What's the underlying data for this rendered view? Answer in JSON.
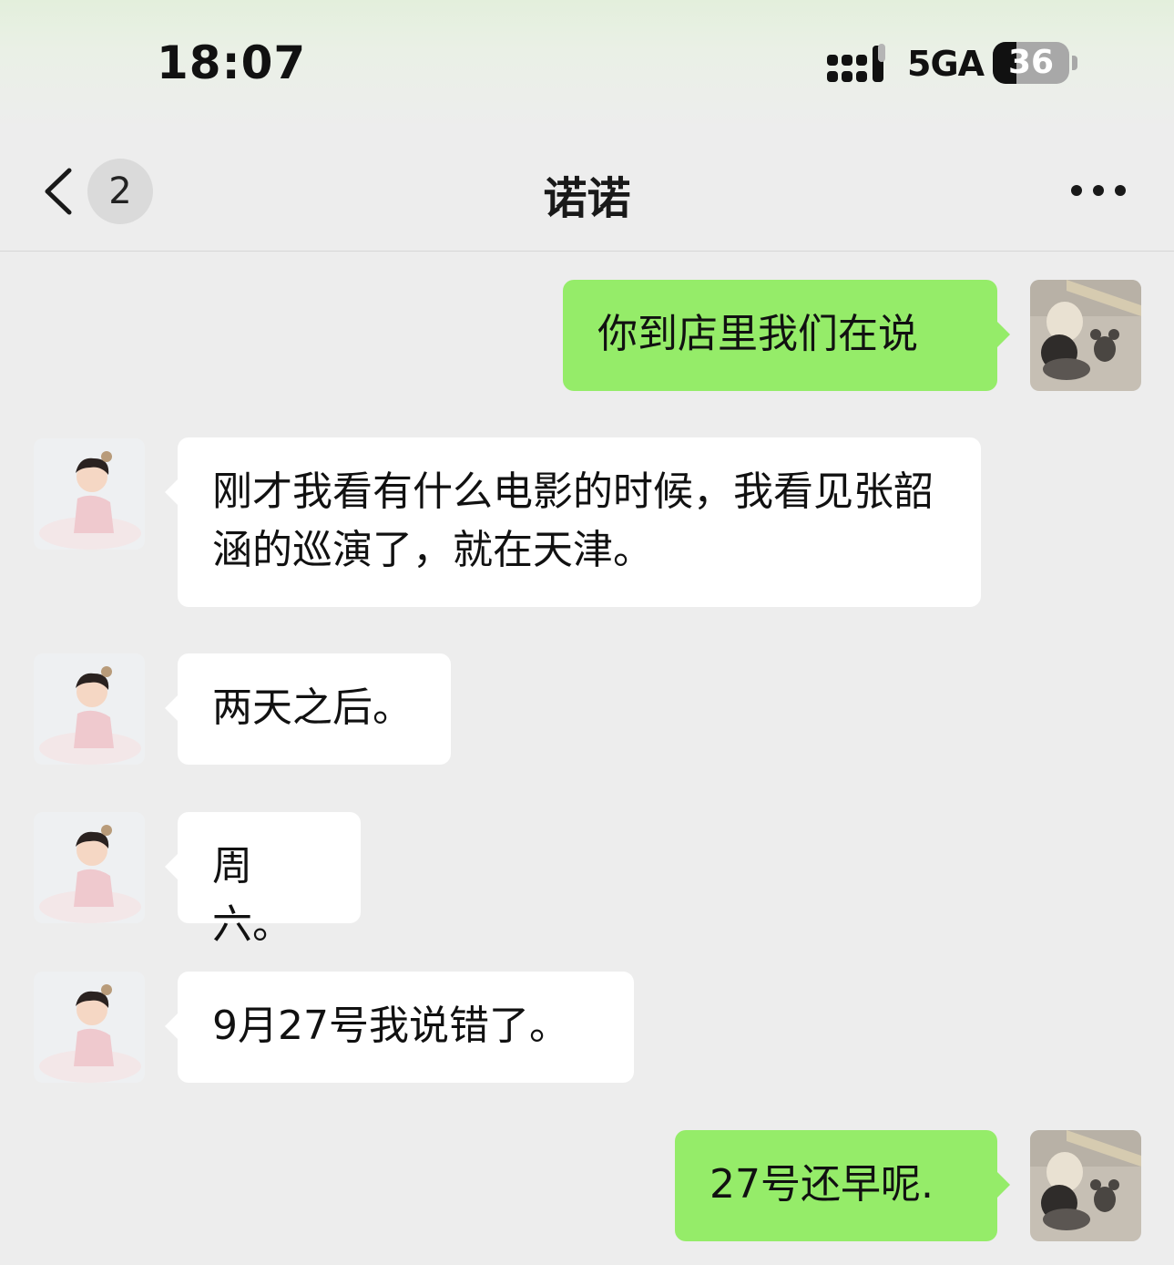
{
  "status_bar": {
    "time": "18:07",
    "network": "5GA",
    "battery_level": "36",
    "battery_fraction": 0.36
  },
  "header": {
    "back_icon": "chevron-left-icon",
    "unread_count": "2",
    "title": "诺诺",
    "more_icon": "more-dots-icon"
  },
  "messages": [
    {
      "direction": "outgoing",
      "text": "你到店里我们在说"
    },
    {
      "direction": "incoming",
      "text": "刚才我看有什么电影的时候，我看见张韶涵的巡演了，就在天津。"
    },
    {
      "direction": "incoming",
      "text": "两天之后。"
    },
    {
      "direction": "incoming",
      "text": "周六。"
    },
    {
      "direction": "incoming",
      "text": "9月27号我说错了。"
    },
    {
      "direction": "outgoing",
      "text": "27号还早呢."
    }
  ],
  "colors": {
    "background": "#ededed",
    "outgoing_bubble": "#95ec69",
    "incoming_bubble": "#ffffff"
  }
}
